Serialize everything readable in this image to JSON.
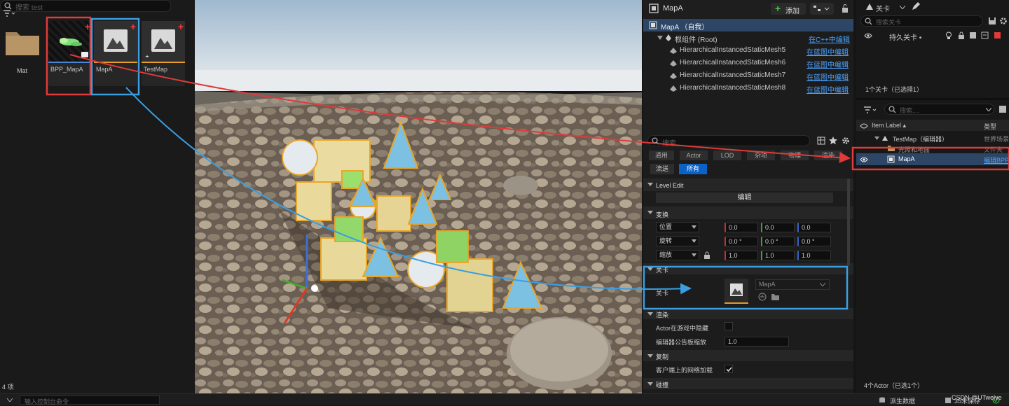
{
  "content_browser": {
    "search_placeholder": "搜索 test",
    "items": [
      {
        "label": "Mat"
      },
      {
        "label": "BPP_MapA"
      },
      {
        "label": "MapA"
      },
      {
        "label": "TestMap"
      }
    ],
    "item_count": "4 项"
  },
  "components": {
    "title": "MapA",
    "add_label": "添加",
    "root_entry": "MapA （自我）",
    "root_component": "根组件 (Root)",
    "root_link": "在C++中编辑",
    "rows": [
      {
        "name": "HierarchicalInstancedStaticMesh5",
        "link": "在蓝图中编辑"
      },
      {
        "name": "HierarchicalInstancedStaticMesh6",
        "link": "在蓝图中编辑"
      },
      {
        "name": "HierarchicalInstancedStaticMesh7",
        "link": "在蓝图中编辑"
      },
      {
        "name": "HierarchicalInstancedStaticMesh8",
        "link": "在蓝图中编辑"
      }
    ]
  },
  "details": {
    "search_placeholder": "搜索",
    "filter_tabs": [
      "通用",
      "Actor",
      "LOD",
      "杂项",
      "物理",
      "渲染"
    ],
    "filter_tab_streaming": "流送",
    "filter_tab_all": "所有",
    "sections": {
      "level_edit": "Level Edit",
      "transform": "变换",
      "level": "关卡",
      "rendering": "渲染",
      "replication": "复制",
      "collision": "碰撞"
    },
    "edit_button": "编辑",
    "transform": {
      "location": {
        "label": "位置",
        "x": "0.0",
        "y": "0.0",
        "z": "0.0"
      },
      "rotation": {
        "label": "旋转",
        "x": "0.0 °",
        "y": "0.0 °",
        "z": "0.0 °"
      },
      "scale": {
        "label": "缩放",
        "x": "1.0",
        "y": "1.0",
        "z": "1.0"
      }
    },
    "level_row": {
      "label": "关卡",
      "asset": "MapA"
    },
    "render_row1": "Actor在游戏中隐藏",
    "render_row2": "编辑器公告板缩放",
    "render_row2_value": "1.0",
    "replication_row": "客户端上的网络加载"
  },
  "levels": {
    "title": "关卡",
    "search_placeholder": "搜索关卡",
    "persistent_label": "持久关卡 •",
    "count_text": "1个关卡（已选择1）"
  },
  "outliner": {
    "search_placeholder": "搜索....",
    "col_label": "Item Label ▴",
    "col_type": "类型",
    "rows": [
      {
        "name": "TestMap（编辑器）",
        "type": "世界场景"
      },
      {
        "name": "光照和地面",
        "type": "文件夹"
      },
      {
        "name": "MapA",
        "type": "编辑BPP"
      }
    ],
    "actor_count": "4个Actor（已选1个）"
  },
  "statusbar": {
    "console_placeholder": "输入控制台命令",
    "derived_data": "派生数据",
    "unsaved": "35未保存",
    "watermark": "CSDN @UTwelve"
  },
  "colors": {
    "accent_blue": "#0a62c6",
    "annotation_red": "#e03a3a",
    "annotation_blue": "#3b9ee0"
  }
}
